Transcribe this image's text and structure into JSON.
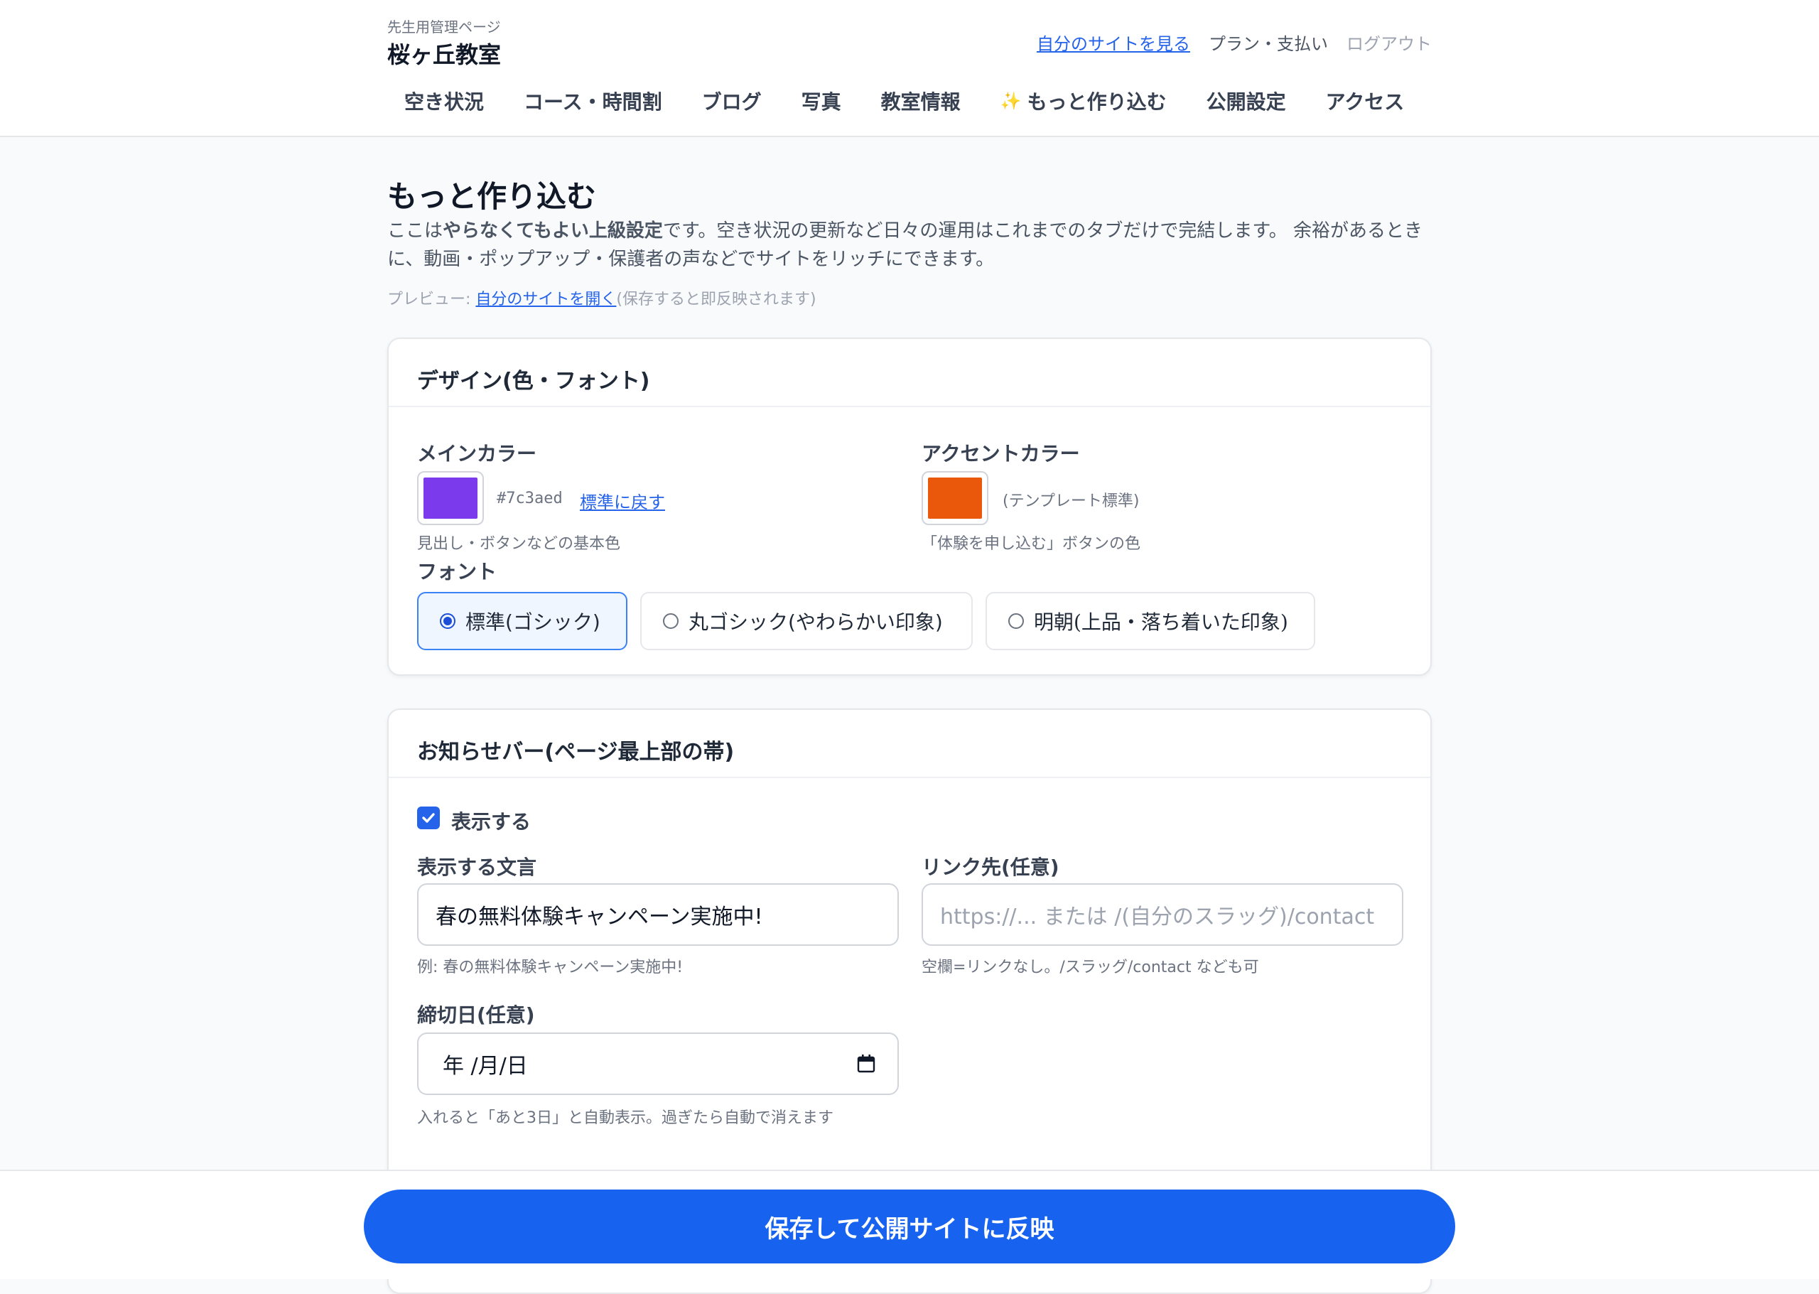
{
  "header": {
    "subtitle": "先生用管理ページ",
    "school_name": "桜ヶ丘教室",
    "links": {
      "view_site": "自分のサイトを見る",
      "plan": "プラン・支払い",
      "logout": "ログアウト"
    },
    "nav": [
      {
        "label": "空き状況"
      },
      {
        "label": "コース・時間割"
      },
      {
        "label": "ブログ"
      },
      {
        "label": "写真"
      },
      {
        "label": "教室情報"
      },
      {
        "label": "もっと作り込む",
        "icon": "sparkle-icon"
      },
      {
        "label": "公開設定"
      },
      {
        "label": "アクセス"
      }
    ]
  },
  "main": {
    "title": "もっと作り込む",
    "intro": {
      "pre": "ここは",
      "bold": "やらなくてもよい上級設定",
      "post": "です。空き状況の更新など日々の運用はこれまでのタブだけで完結します。 余裕があるときに、動画・ポップアップ・保護者の声などでサイトをリッチにできます。"
    },
    "preview": {
      "label": "プレビュー: ",
      "link": "自分のサイトを開く",
      "note": "(保存すると即反映されます)"
    }
  },
  "design_card": {
    "title": "デザイン(色・フォント)",
    "main_color": {
      "label": "メインカラー",
      "value": "#7c3aed",
      "hex_text": "#7c3aed",
      "reset": "標準に戻す",
      "help": "見出し・ボタンなどの基本色"
    },
    "accent_color": {
      "label": "アクセントカラー",
      "value": "#ea580c",
      "note": "(テンプレート標準)",
      "help": "「体験を申し込む」ボタンの色"
    },
    "font": {
      "label": "フォント",
      "options": [
        {
          "label": "標準(ゴシック)",
          "selected": true
        },
        {
          "label": "丸ゴシック(やわらかい印象)",
          "selected": false
        },
        {
          "label": "明朝(上品・落ち着いた印象)",
          "selected": false
        }
      ]
    }
  },
  "notice_card": {
    "title": "お知らせバー(ページ最上部の帯)",
    "show": {
      "label": "表示する",
      "checked": true
    },
    "text_field": {
      "label": "表示する文言",
      "value": "春の無料体験キャンペーン実施中!",
      "help": "例: 春の無料体験キャンペーン実施中!"
    },
    "link_field": {
      "label": "リンク先(任意)",
      "placeholder": "https://... または /(自分のスラッグ)/contact",
      "help": "空欄=リンクなし。/スラッグ/contact なども可"
    },
    "deadline_field": {
      "label": "締切日(任意)",
      "value": "年 /月/日",
      "help": "入れると「あと3日」と自動表示。過ぎたら自動で消えます"
    }
  },
  "footer": {
    "save_label": "保存して公開サイトに反映"
  },
  "colors": {
    "primary": "#1763f0",
    "link": "#2563eb",
    "main_color": "#7c3aed",
    "accent_color": "#ea580c"
  }
}
